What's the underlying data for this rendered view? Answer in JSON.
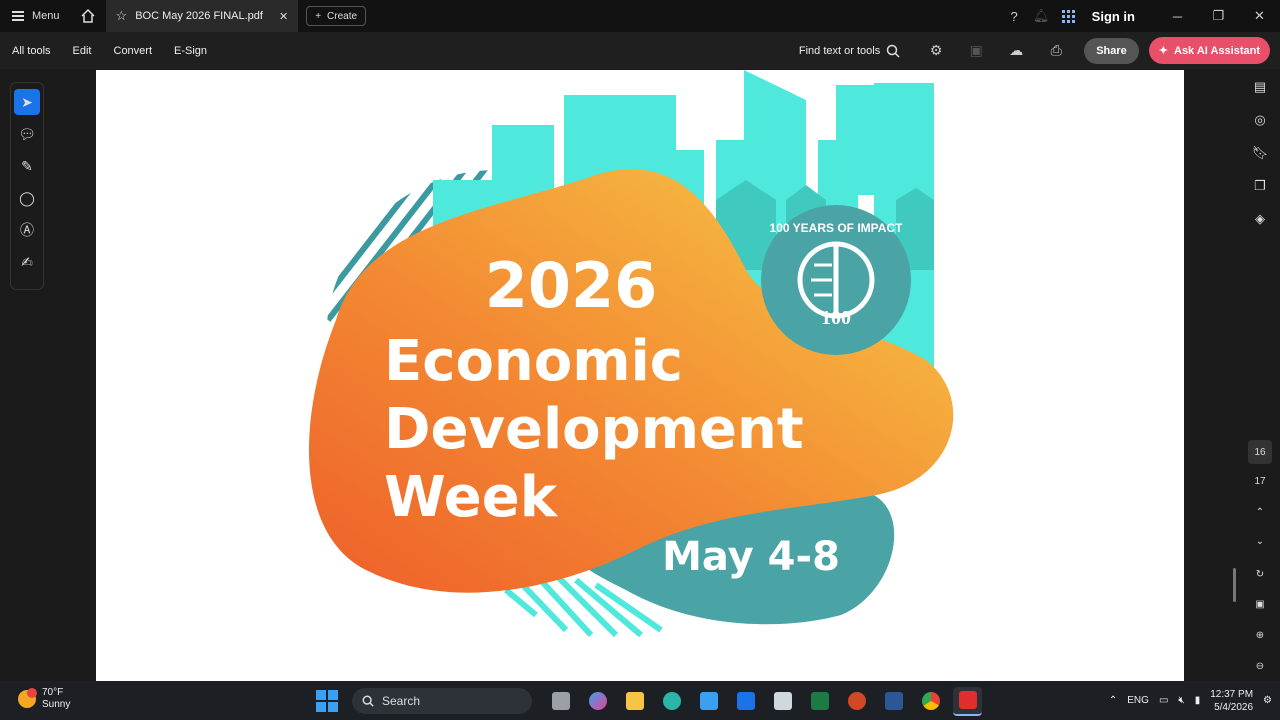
{
  "titlebar": {
    "menu_label": "Menu",
    "tab_title": "BOC May 2026 FINAL.pdf",
    "create_label": "Create",
    "signin_label": "Sign in"
  },
  "toolbar": {
    "items": [
      "All tools",
      "Edit",
      "Convert",
      "E-Sign"
    ],
    "find_label": "Find text or tools",
    "share_label": "Share",
    "ai_label": "Ask AI Assistant"
  },
  "document": {
    "year": "2026",
    "line1": "Economic",
    "line2": "Development",
    "line3": "Week",
    "dates": "May 4-8",
    "badge_text": "100 YEARS OF IMPACT",
    "badge_number": "100"
  },
  "pages": {
    "current": "16",
    "next": "17"
  },
  "taskbar": {
    "temperature": "70°F",
    "condition": "Sunny",
    "search_label": "Search",
    "language": "ENG",
    "time": "12:37 PM",
    "date": "5/4/2026"
  },
  "colors": {
    "orange": "#f07a2e",
    "yellow": "#f6c544",
    "teal": "#4aa3a5",
    "aqua": "#4ee8dc",
    "ai_button": "#e8506a"
  }
}
